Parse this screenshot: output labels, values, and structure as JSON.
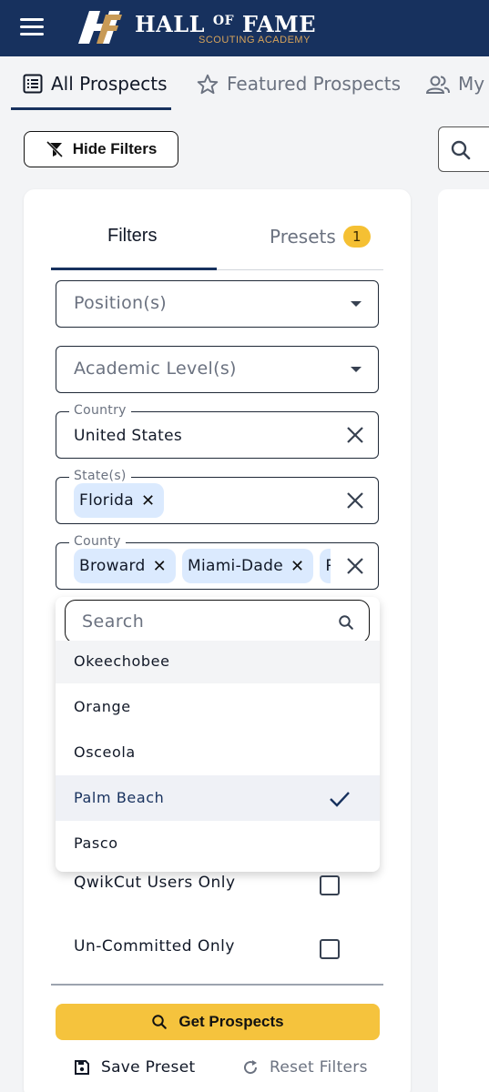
{
  "header": {
    "logo_mark": "HF",
    "title_main_1": "HALL",
    "title_of": "OF",
    "title_main_2": "FAME",
    "subtitle": "SCOUTING ACADEMY",
    "menu_icon": "hamburger-icon"
  },
  "tabs": [
    {
      "label": "All Prospects",
      "icon": "list-icon",
      "active": true
    },
    {
      "label": "Featured Prospects",
      "icon": "star-icon",
      "active": false
    },
    {
      "label": "My",
      "icon": "users-icon",
      "active": false
    }
  ],
  "toolbar": {
    "hide_filters_label": "Hide Filters",
    "hide_filters_icon": "filter-off-icon",
    "search_icon": "search-icon"
  },
  "card": {
    "tab_filters": "Filters",
    "tab_presets": "Presets",
    "presets_count": "1"
  },
  "fields": {
    "position_placeholder": "Position(s)",
    "academic_placeholder": "Academic Level(s)",
    "country_label": "Country",
    "country_value": "United States",
    "state_label": "State(s)",
    "state_chips": [
      "Florida"
    ],
    "county_label": "County",
    "county_chips": [
      "Broward",
      "Miami-Dade",
      "P"
    ]
  },
  "dropdown": {
    "search_placeholder": "Search",
    "options": [
      {
        "label": "Okeechobee",
        "state": "hover"
      },
      {
        "label": "Orange",
        "state": "normal"
      },
      {
        "label": "Osceola",
        "state": "normal"
      },
      {
        "label": "Palm Beach",
        "state": "selected"
      },
      {
        "label": "Pasco",
        "state": "normal"
      }
    ]
  },
  "checkboxes": {
    "qwikcut_label": "QwikCut Users Only",
    "qwikcut_checked": false,
    "uncommitted_label": "Un-Committed Only",
    "uncommitted_checked": false
  },
  "actions": {
    "get_prospects": "Get Prospects",
    "save_preset": "Save Preset",
    "reset_filters": "Reset Filters"
  },
  "colors": {
    "navy": "#17315e",
    "gold": "#f5c33d",
    "chip_bg": "#dbeafe"
  }
}
